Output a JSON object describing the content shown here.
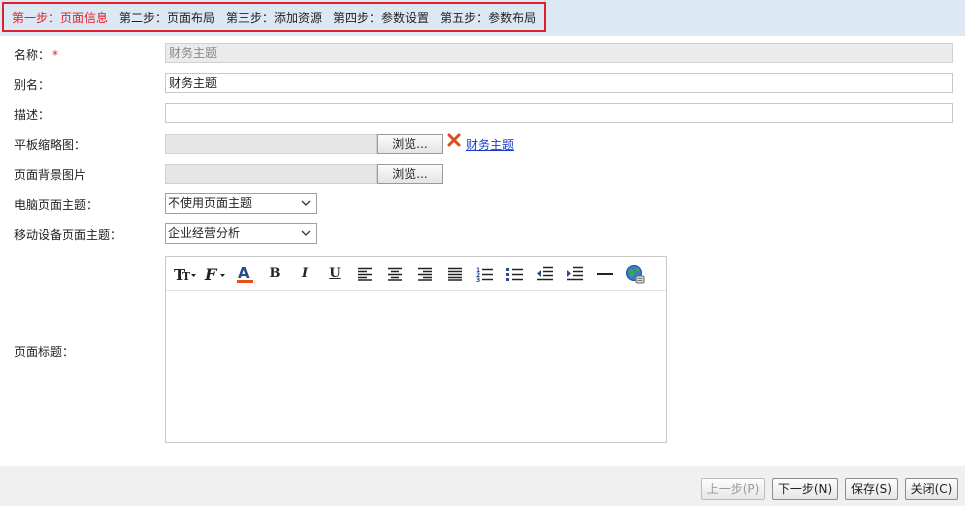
{
  "steps": [
    {
      "label": "第一步：页面信息",
      "active": true
    },
    {
      "label": "第二步：页面布局"
    },
    {
      "label": "第三步：添加资源"
    },
    {
      "label": "第四步：参数设置"
    },
    {
      "label": "第五步：参数布局"
    }
  ],
  "form": {
    "name": {
      "label": "名称：",
      "required_mark": "*",
      "value": "财务主题"
    },
    "alias": {
      "label": "别名：",
      "value": "财务主题"
    },
    "description": {
      "label": "描述：",
      "value": ""
    },
    "thumbnail": {
      "label": "平板缩略图：",
      "browse_label": "浏览...",
      "file_link": "财务主题"
    },
    "background": {
      "label": "页面背景图片",
      "browse_label": "浏览..."
    },
    "pc_theme": {
      "label": "电脑页面主题：",
      "selected": "不使用页面主题"
    },
    "mobile_theme": {
      "label": "移动设备页面主题：",
      "selected": "企业经营分析"
    },
    "page_title": {
      "label": "页面标题："
    }
  },
  "editor": {
    "toolbar_icons": [
      "font-size-icon",
      "font-family-icon",
      "font-color-icon",
      "bold-icon",
      "italic-icon",
      "underline-icon",
      "align-left-icon",
      "align-center-icon",
      "align-right-icon",
      "justify-icon",
      "ordered-list-icon",
      "unordered-list-icon",
      "outdent-icon",
      "indent-icon",
      "horizontal-rule-icon",
      "insert-link-icon"
    ],
    "bold_glyph": "B",
    "italic_glyph": "I",
    "underline_glyph": "U",
    "color_glyph": "A"
  },
  "footer": {
    "prev": "上一步(P)",
    "next": "下一步(N)",
    "save": "保存(S)",
    "close": "关闭(C)"
  },
  "colors": {
    "active_step": "#e0202a",
    "header_bg": "#dce8f4",
    "link": "#1a3cc8",
    "font_color_bar": "#e8501a"
  }
}
